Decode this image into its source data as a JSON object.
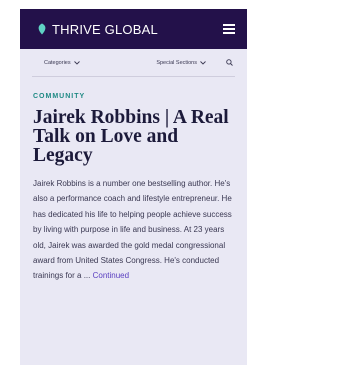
{
  "header": {
    "logo_text": "THRIVE GLOBAL",
    "logo_icon": "thrive-leaf-icon",
    "menu_icon": "hamburger-menu-icon",
    "background": "#23114a"
  },
  "subnav": {
    "categories_label": "Categories",
    "special_sections_label": "Special Sections",
    "search_icon": "search-icon"
  },
  "article": {
    "category": "COMMUNITY",
    "title": "Jairek Robbins | A Real Talk on Love and Legacy",
    "excerpt": "Jairek Robbins is a number one bestselling author. He's also a performance coach and lifestyle entrepreneur. He has dedicated his life to helping people achieve success by living with purpose in life and business. At 23 years old, Jairek was awarded the gold medal congressional award from United States Congress. He's conducted trainings for a ...",
    "continued_label": "Continued"
  },
  "colors": {
    "accent_teal": "#1f8a84",
    "link_purple": "#5a3fc0",
    "page_background": "#e9e8f4"
  }
}
